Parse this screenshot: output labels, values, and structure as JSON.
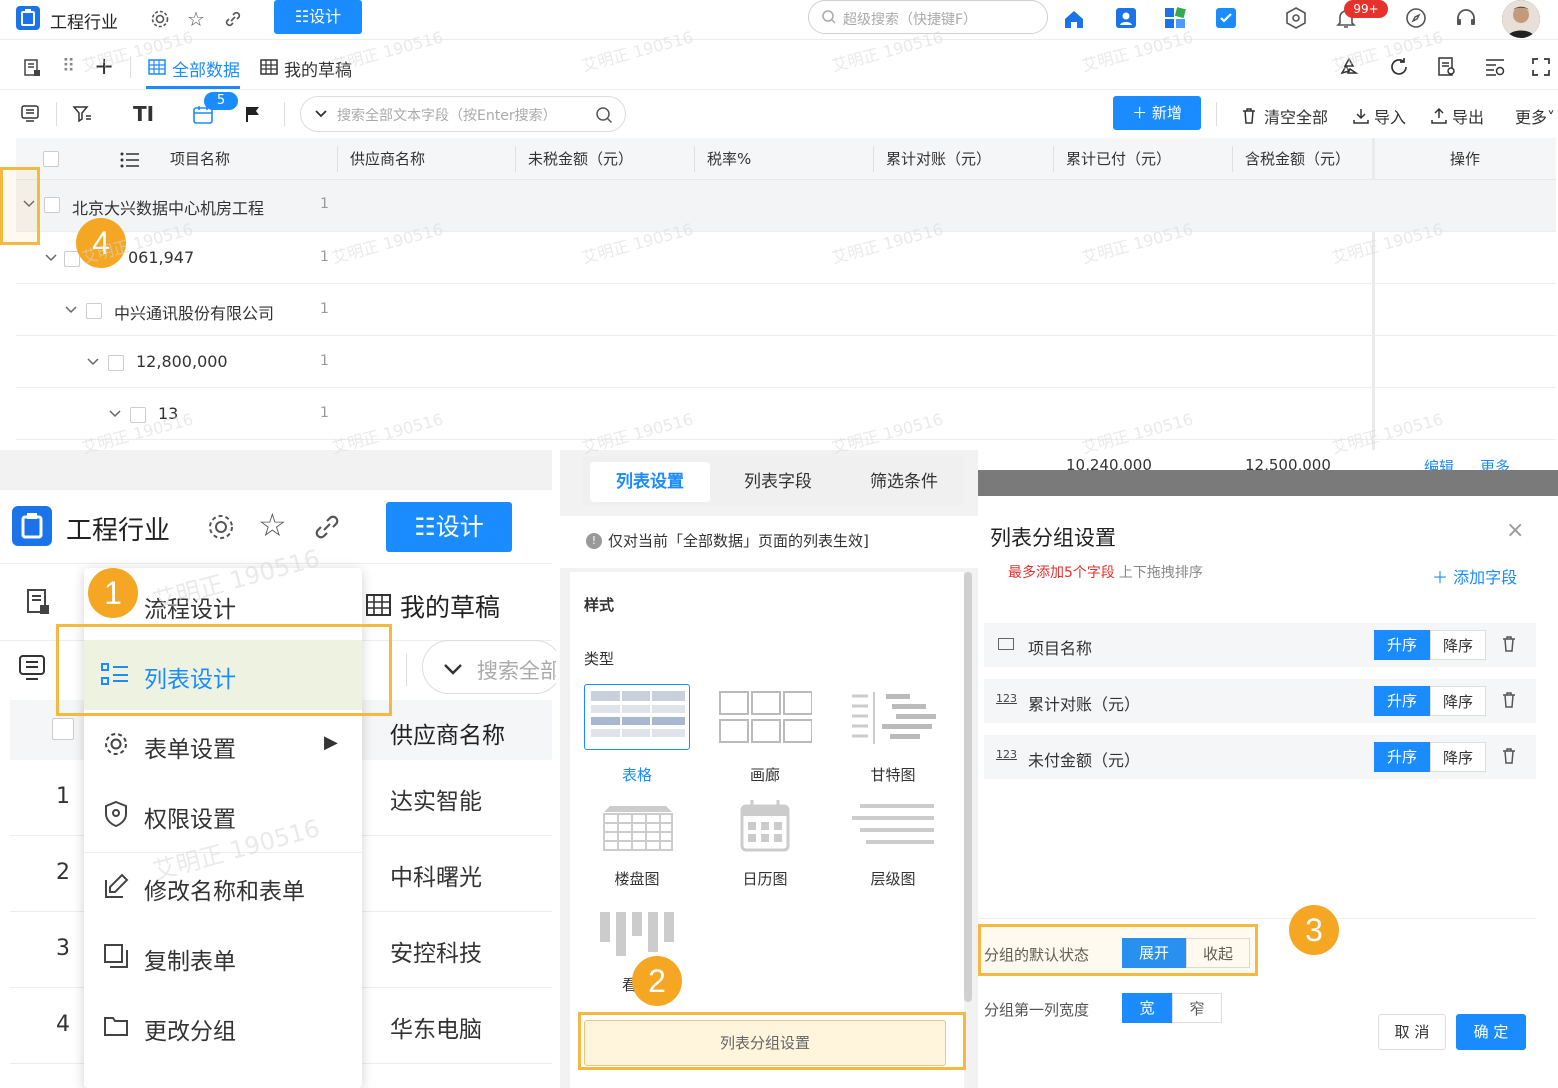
{
  "topbar": {
    "app_title": "工程行业",
    "design_btn": "☷设计",
    "search_placeholder": "超级搜索（快捷键F）",
    "notif_badge": "99+"
  },
  "tabs": {
    "all_data": "全部数据",
    "my_drafts": "我的草稿"
  },
  "toolbar": {
    "badge_count": "5",
    "search_placeholder": "搜索全部文本字段（按Enter搜索）",
    "add_btn": "＋ 新增",
    "clear_all": "清空全部",
    "import": "导入",
    "export": "导出",
    "more": "更多"
  },
  "table": {
    "headers": [
      "项目名称",
      "供应商名称",
      "未税金额（元）",
      "税率%",
      "累计对账（元）",
      "累计已付（元）",
      "含税金额（元）",
      "操作"
    ],
    "group_rows": [
      {
        "label": "北京大兴数据中心机房工程",
        "count": "1"
      },
      {
        "label": "061,947",
        "count": "1"
      },
      {
        "label": "中兴通讯股份有限公司",
        "count": "1"
      },
      {
        "label": "12,800,000",
        "count": "1"
      },
      {
        "label": "13",
        "count": "1"
      }
    ],
    "partial_row": {
      "reconciled": "10,240,000",
      "tax_included": "12,500,000",
      "edit": "编辑",
      "more": "更多"
    }
  },
  "watermark": "艾明正 190516",
  "left_panel": {
    "app_title": "工程行业",
    "design_btn": "☷设计",
    "my_drafts": "我的草稿",
    "search_placeholder": "搜索全部",
    "supplier_header": "供应商名称",
    "rows": [
      {
        "num": "1",
        "supplier": "达实智能"
      },
      {
        "num": "2",
        "supplier": "中科曙光"
      },
      {
        "num": "3",
        "supplier": "安控科技"
      },
      {
        "num": "4",
        "supplier": "华东电脑"
      }
    ],
    "menu": [
      {
        "label": "流程设计",
        "icon": "flow-icon"
      },
      {
        "label": "列表设计",
        "icon": "list-icon"
      },
      {
        "label": "表单设置",
        "icon": "gear-icon"
      },
      {
        "label": "权限设置",
        "icon": "shield-icon"
      },
      {
        "label": "修改名称和表单",
        "icon": "edit-icon"
      },
      {
        "label": "复制表单",
        "icon": "copy-icon"
      },
      {
        "label": "更改分组",
        "icon": "folder-icon"
      }
    ]
  },
  "middle_panel": {
    "tabs": [
      "列表设置",
      "列表字段",
      "筛选条件"
    ],
    "notice": "仅对当前「全部数据」页面的列表生效]",
    "style_label": "样式",
    "type_label": "类型",
    "types": [
      "表格",
      "画廊",
      "甘特图",
      "楼盘图",
      "日历图",
      "层级图",
      "看板"
    ],
    "group_btn": "列表分组设置"
  },
  "dialog": {
    "title": "列表分组设置",
    "hint_red": "最多添加5个字段",
    "hint_gray": "上下拖拽排序",
    "add_field": "＋ 添加字段",
    "fields": [
      {
        "type": "text",
        "name": "项目名称"
      },
      {
        "type": "123",
        "name": "累计对账（元）"
      },
      {
        "type": "123",
        "name": "未付金额（元）"
      }
    ],
    "asc": "升序",
    "desc": "降序",
    "default_state_label": "分组的默认状态",
    "expand": "展开",
    "collapse": "收起",
    "width_label": "分组第一列宽度",
    "wide": "宽",
    "narrow": "窄",
    "cancel": "取 消",
    "ok": "确 定"
  },
  "step_badges": [
    "1",
    "2",
    "3",
    "4"
  ],
  "colors": {
    "primary": "#1a8cff",
    "highlight": "#f5b942",
    "badge": "#f5a623",
    "red": "#e5322d"
  }
}
